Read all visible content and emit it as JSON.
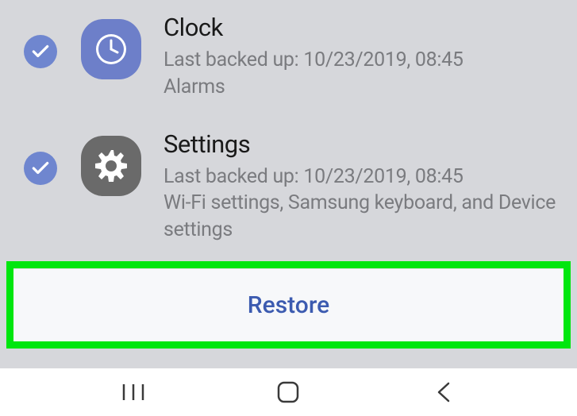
{
  "items": [
    {
      "title": "Clock",
      "backup": "Last backed up: 10/23/2019, 08:45",
      "detail": "Alarms",
      "icon": "clock-icon",
      "checked": true
    },
    {
      "title": "Settings",
      "backup": "Last backed up: 10/23/2019, 08:45",
      "detail": "Wi-Fi settings, Samsung keyboard, and Device settings",
      "icon": "gear-icon",
      "checked": true
    }
  ],
  "restore_label": "Restore"
}
